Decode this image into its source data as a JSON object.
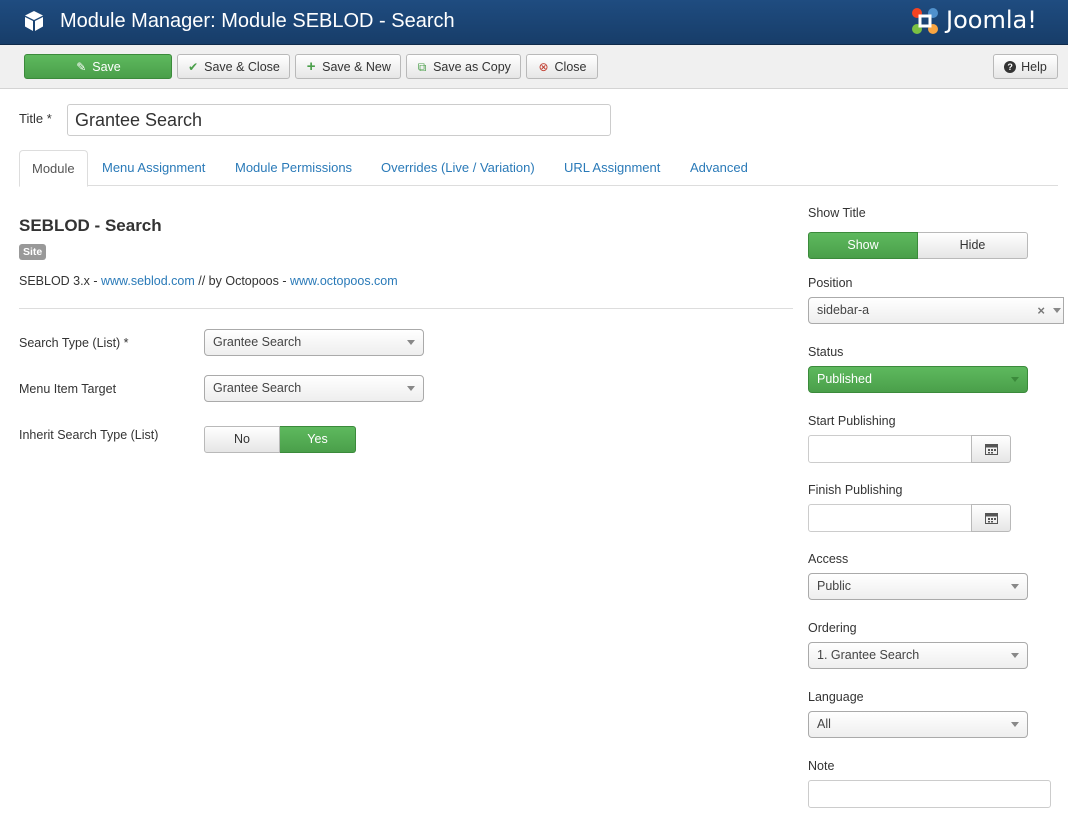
{
  "header": {
    "title": "Module Manager: Module SEBLOD - Search",
    "logo_text": "Joomla!"
  },
  "toolbar": {
    "save": "Save",
    "save_close": "Save & Close",
    "save_new": "Save & New",
    "save_copy": "Save as Copy",
    "close": "Close",
    "help": "Help"
  },
  "title_field": {
    "label": "Title *",
    "value": "Grantee Search"
  },
  "tabs": [
    {
      "label": "Module"
    },
    {
      "label": "Menu Assignment"
    },
    {
      "label": "Module Permissions"
    },
    {
      "label": "Overrides (Live / Variation)"
    },
    {
      "label": "URL Assignment"
    },
    {
      "label": "Advanced"
    }
  ],
  "module": {
    "name": "SEBLOD - Search",
    "badge": "Site",
    "desc_prefix": "SEBLOD 3.x - ",
    "link1": "www.seblod.com",
    "desc_mid": " // by Octopoos - ",
    "link2": "www.octopoos.com"
  },
  "fields": {
    "search_type_label": "Search Type (List) *",
    "search_type_value": "Grantee Search",
    "menu_target_label": "Menu Item Target",
    "menu_target_value": "Grantee Search",
    "inherit_label": "Inherit Search Type (List)",
    "inherit_no": "No",
    "inherit_yes": "Yes"
  },
  "sidebar": {
    "show_title_label": "Show Title",
    "show": "Show",
    "hide": "Hide",
    "position_label": "Position",
    "position_value": "sidebar-a",
    "status_label": "Status",
    "status_value": "Published",
    "start_label": "Start Publishing",
    "finish_label": "Finish Publishing",
    "access_label": "Access",
    "access_value": "Public",
    "ordering_label": "Ordering",
    "ordering_value": "1. Grantee Search",
    "language_label": "Language",
    "language_value": "All",
    "note_label": "Note"
  },
  "colors": {
    "header_bg": "#1f4c80",
    "success": "#51a351",
    "link": "#2a7ab8"
  }
}
